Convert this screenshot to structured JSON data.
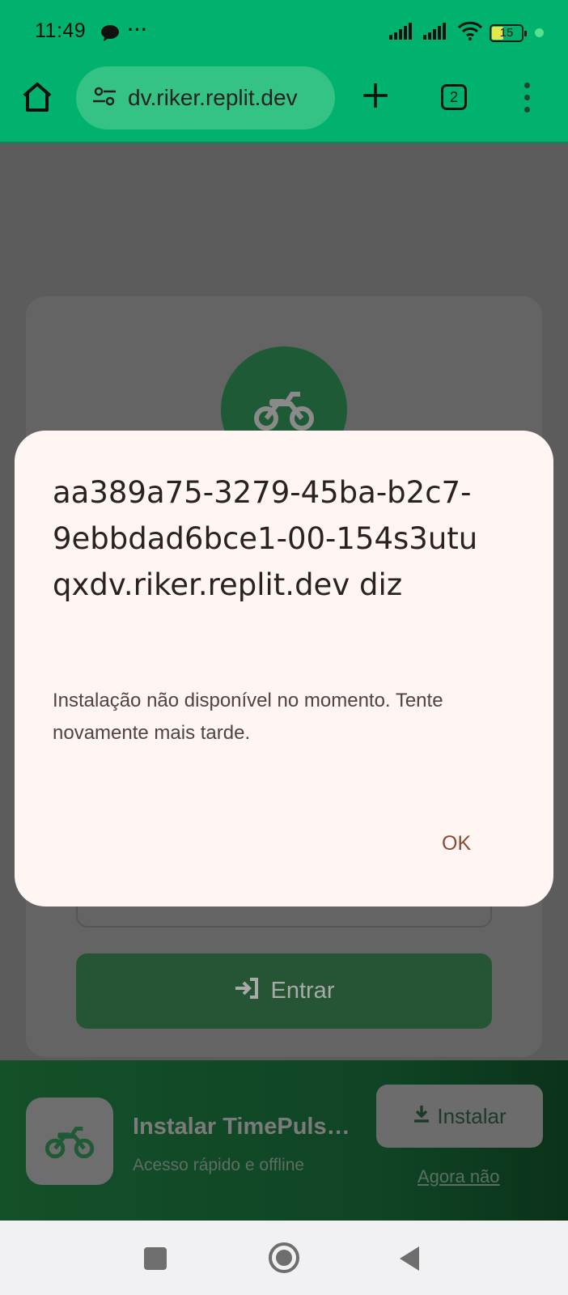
{
  "status_bar": {
    "time": "11:49",
    "battery": "15",
    "icons": [
      "chat-icon",
      "signal-icon",
      "signal-icon",
      "wifi-icon",
      "battery-icon"
    ]
  },
  "browser": {
    "url": "dv.riker.replit.dev",
    "tab_count": "2"
  },
  "dialog": {
    "title": "aa389a75-3279-45ba-b2c7-9ebbdad6bce1-00-154s3utuqxdv.riker.replit.dev diz",
    "message": "Instalação não disponível no momento. Tente novamente mais tarde.",
    "ok_label": "OK"
  },
  "page": {
    "login_button_label": "Entrar"
  },
  "install_banner": {
    "title": "Instalar TimePuls…",
    "subtitle": "Acesso rápido e offline",
    "install_label": "Instalar",
    "dismiss_label": "Agora não"
  },
  "colors": {
    "browser_chrome": "#00b26d",
    "dialog_bg": "#fff5f3",
    "accent": "#8b4a34"
  }
}
